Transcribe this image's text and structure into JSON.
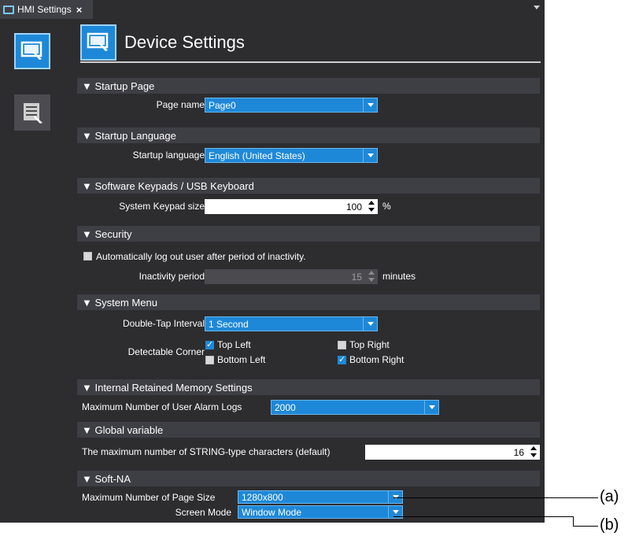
{
  "tab": {
    "title": "HMI Settings",
    "close": "×"
  },
  "header": {
    "title": "Device Settings"
  },
  "sections": {
    "startup_page": "▼ Startup Page",
    "startup_language": "▼ Startup Language",
    "keypads": "▼ Software Keypads / USB Keyboard",
    "security": "▼ Security",
    "system_menu": "▼ System Menu",
    "retained_memory": "▼ Internal Retained Memory Settings",
    "global_variable": "▼ Global variable",
    "soft_na": "▼ Soft-NA"
  },
  "fields": {
    "page_name": {
      "label": "Page name",
      "value": "Page0"
    },
    "startup_language": {
      "label": "Startup language",
      "value": "English (United States)"
    },
    "keypad_size": {
      "label": "System Keypad size",
      "value": "100",
      "unit": "%"
    },
    "auto_logout": {
      "label": "Automatically log out user after period of inactivity.",
      "checked": false
    },
    "inactivity_period": {
      "label": "Inactivity period",
      "value": "15",
      "unit": "minutes"
    },
    "double_tap": {
      "label": "Double-Tap Interval",
      "value": "1 Second"
    },
    "detectable_corner": {
      "label": "Detectable Corner",
      "top_left": {
        "label": "Top Left",
        "checked": true
      },
      "top_right": {
        "label": "Top Right",
        "checked": false
      },
      "bottom_left": {
        "label": "Bottom Left",
        "checked": false
      },
      "bottom_right": {
        "label": "Bottom Right",
        "checked": true
      }
    },
    "max_alarm_logs": {
      "label": "Maximum Number of User Alarm Logs",
      "value": "2000"
    },
    "max_string_chars": {
      "label": "The maximum number of STRING-type characters (default)",
      "value": "16"
    },
    "max_page_size": {
      "label": "Maximum Number of Page Size",
      "value": "1280x800"
    },
    "screen_mode": {
      "label": "Screen Mode",
      "value": "Window Mode"
    }
  },
  "callouts": {
    "a": "(a)",
    "b": "(b)"
  },
  "colors": {
    "accent": "#1e88d8",
    "panel": "#2d2d30",
    "section": "#3e3e45"
  }
}
